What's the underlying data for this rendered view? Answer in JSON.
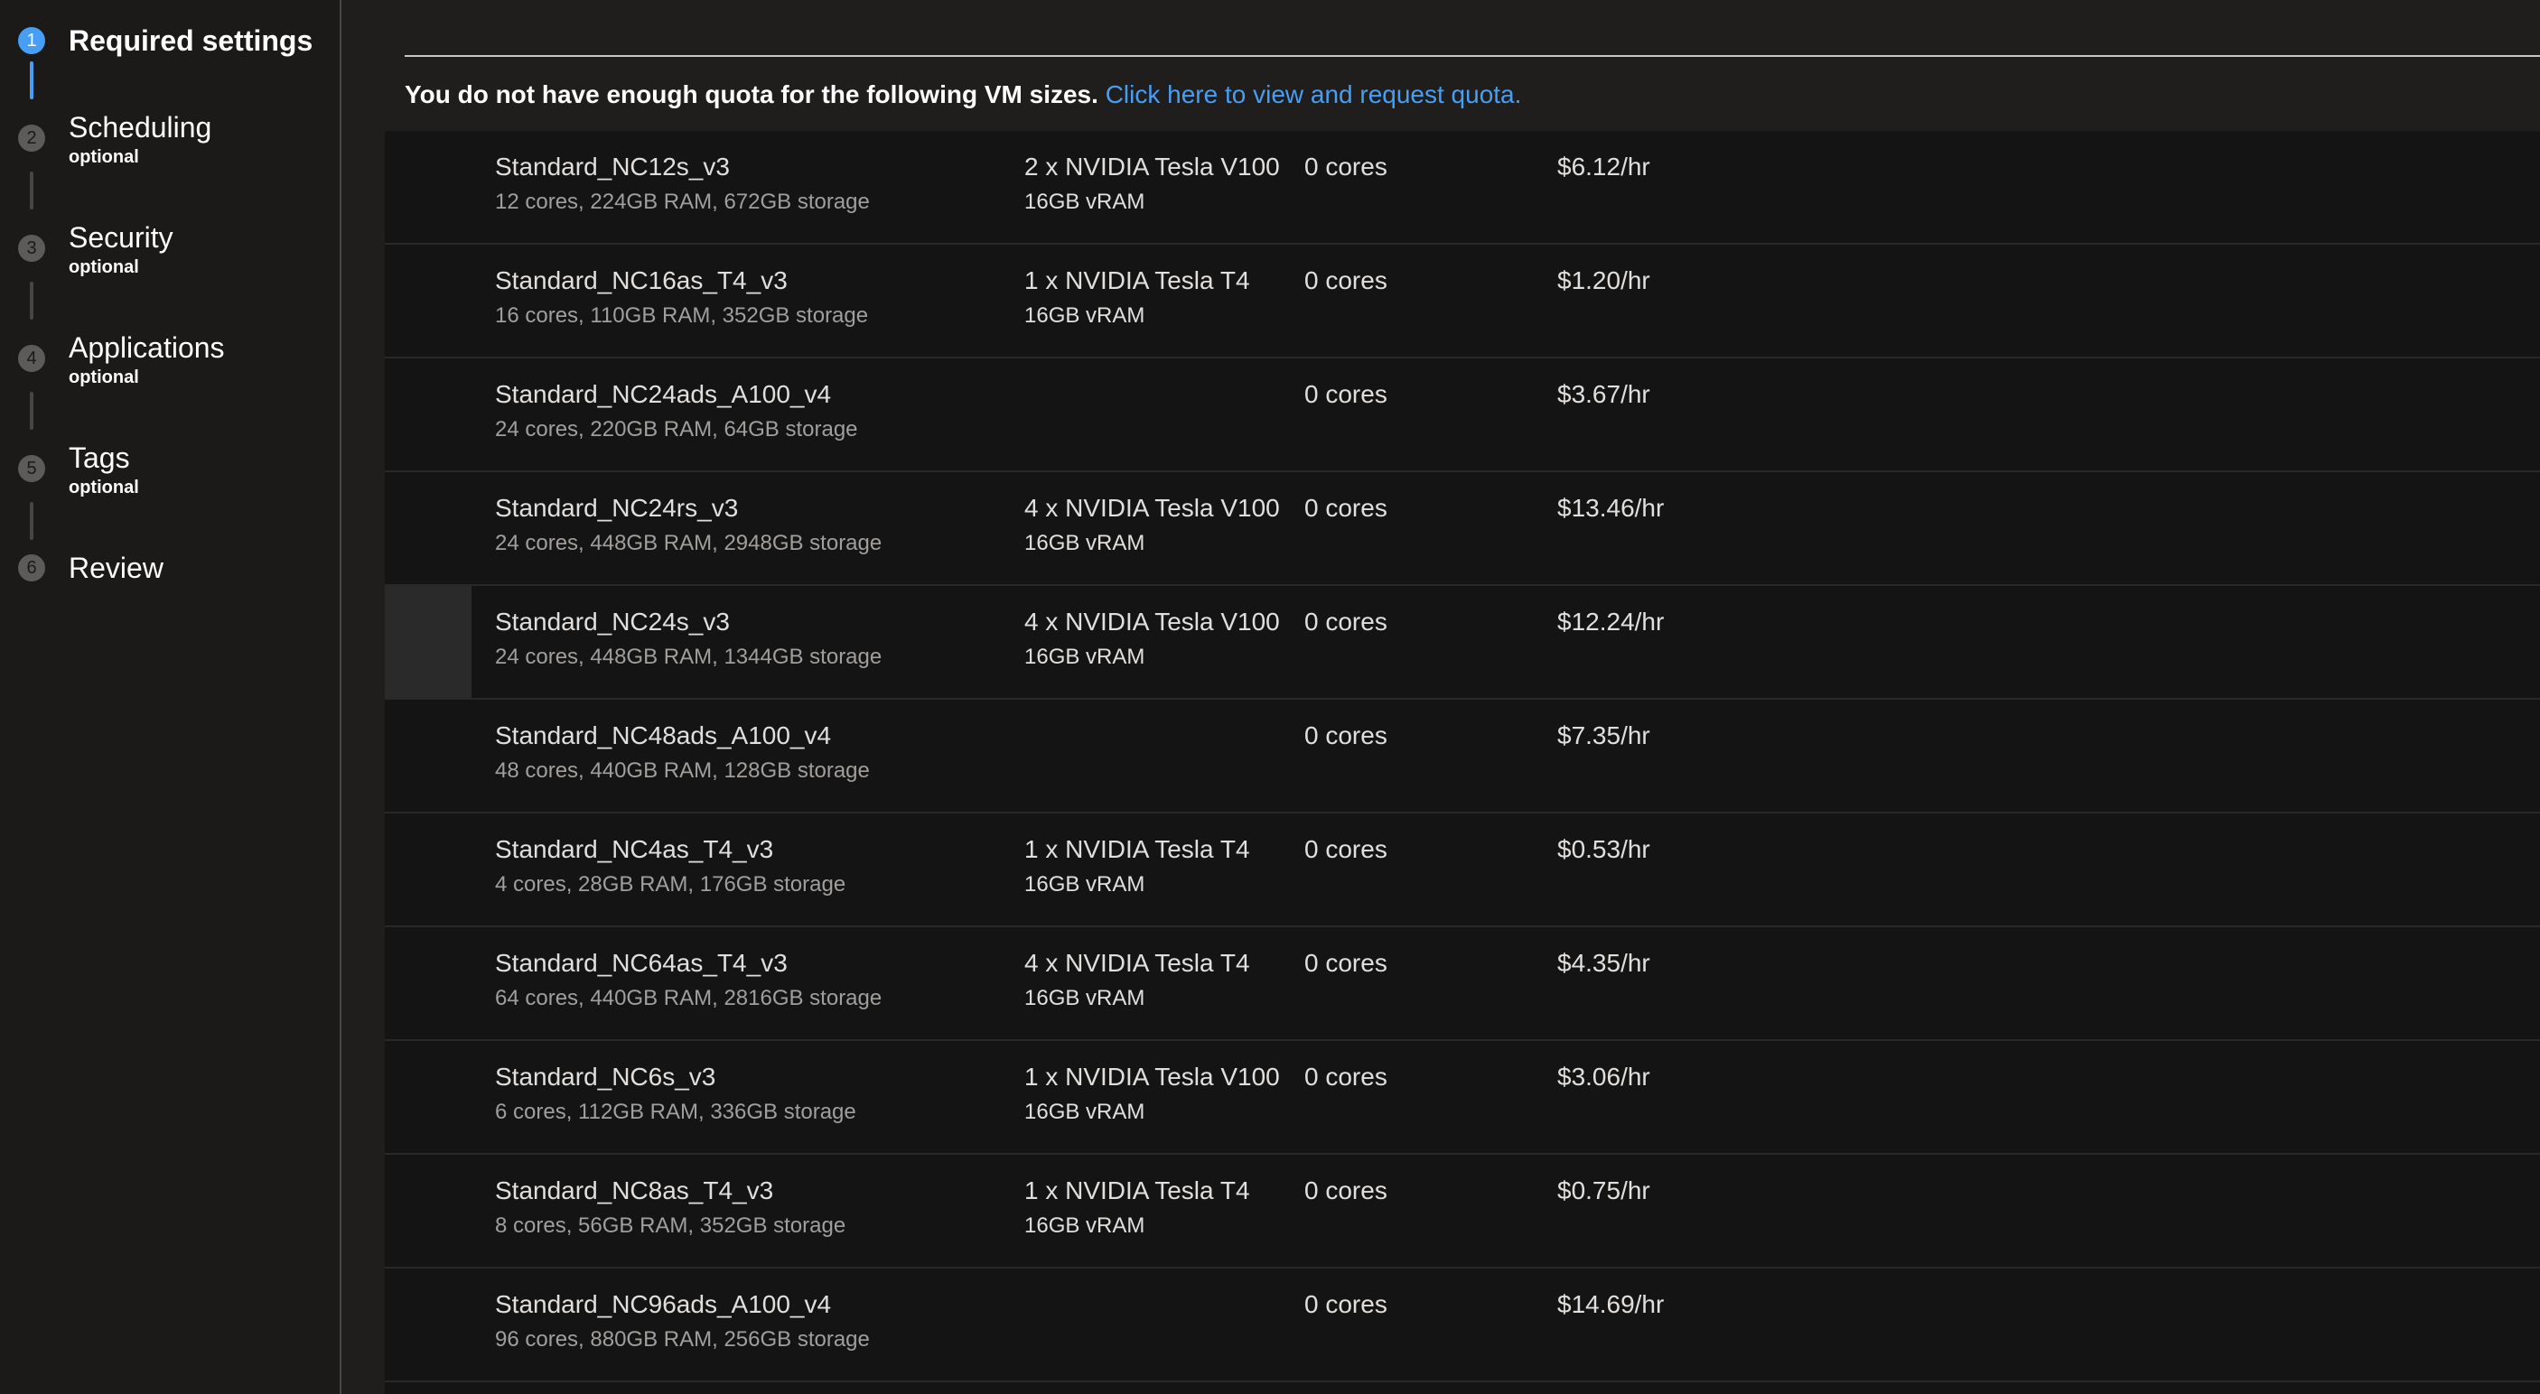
{
  "stepper": {
    "steps": [
      {
        "number": "1",
        "title": "Required settings",
        "subtitle": "",
        "active": true
      },
      {
        "number": "2",
        "title": "Scheduling",
        "subtitle": "optional",
        "active": false
      },
      {
        "number": "3",
        "title": "Security",
        "subtitle": "optional",
        "active": false
      },
      {
        "number": "4",
        "title": "Applications",
        "subtitle": "optional",
        "active": false
      },
      {
        "number": "5",
        "title": "Tags",
        "subtitle": "optional",
        "active": false
      },
      {
        "number": "6",
        "title": "Review",
        "subtitle": "",
        "active": false
      }
    ]
  },
  "notice": {
    "text": "You do not have enough quota for the following VM sizes.",
    "link": "Click here to view and request quota."
  },
  "vm_sizes": [
    {
      "name": "Standard_NC12s_v3",
      "spec": "12 cores, 224GB RAM, 672GB storage",
      "gpu": "2 x NVIDIA Tesla V100",
      "vram": "16GB vRAM",
      "quota": "0 cores",
      "price": "$6.12/hr"
    },
    {
      "name": "Standard_NC16as_T4_v3",
      "spec": "16 cores, 110GB RAM, 352GB storage",
      "gpu": "1 x NVIDIA Tesla T4",
      "vram": "16GB vRAM",
      "quota": "0 cores",
      "price": "$1.20/hr"
    },
    {
      "name": "Standard_NC24ads_A100_v4",
      "spec": "24 cores, 220GB RAM, 64GB storage",
      "gpu": "",
      "vram": "",
      "quota": "0 cores",
      "price": "$3.67/hr"
    },
    {
      "name": "Standard_NC24rs_v3",
      "spec": "24 cores, 448GB RAM, 2948GB storage",
      "gpu": "4 x NVIDIA Tesla V100",
      "vram": "16GB vRAM",
      "quota": "0 cores",
      "price": "$13.46/hr"
    },
    {
      "name": "Standard_NC24s_v3",
      "spec": "24 cores, 448GB RAM, 1344GB storage",
      "gpu": "4 x NVIDIA Tesla V100",
      "vram": "16GB vRAM",
      "quota": "0 cores",
      "price": "$12.24/hr",
      "hovered": true
    },
    {
      "name": "Standard_NC48ads_A100_v4",
      "spec": "48 cores, 440GB RAM, 128GB storage",
      "gpu": "",
      "vram": "",
      "quota": "0 cores",
      "price": "$7.35/hr"
    },
    {
      "name": "Standard_NC4as_T4_v3",
      "spec": "4 cores, 28GB RAM, 176GB storage",
      "gpu": "1 x NVIDIA Tesla T4",
      "vram": "16GB vRAM",
      "quota": "0 cores",
      "price": "$0.53/hr"
    },
    {
      "name": "Standard_NC64as_T4_v3",
      "spec": "64 cores, 440GB RAM, 2816GB storage",
      "gpu": "4 x NVIDIA Tesla T4",
      "vram": "16GB vRAM",
      "quota": "0 cores",
      "price": "$4.35/hr"
    },
    {
      "name": "Standard_NC6s_v3",
      "spec": "6 cores, 112GB RAM, 336GB storage",
      "gpu": "1 x NVIDIA Tesla V100",
      "vram": "16GB vRAM",
      "quota": "0 cores",
      "price": "$3.06/hr"
    },
    {
      "name": "Standard_NC8as_T4_v3",
      "spec": "8 cores, 56GB RAM, 352GB storage",
      "gpu": "1 x NVIDIA Tesla T4",
      "vram": "16GB vRAM",
      "quota": "0 cores",
      "price": "$0.75/hr"
    },
    {
      "name": "Standard_NC96ads_A100_v4",
      "spec": "96 cores, 880GB RAM, 256GB storage",
      "gpu": "",
      "vram": "",
      "quota": "0 cores",
      "price": "$14.69/hr"
    }
  ],
  "theme": {
    "accent": "#479ef5",
    "background": "#1b1a19",
    "list_background": "#141414"
  }
}
